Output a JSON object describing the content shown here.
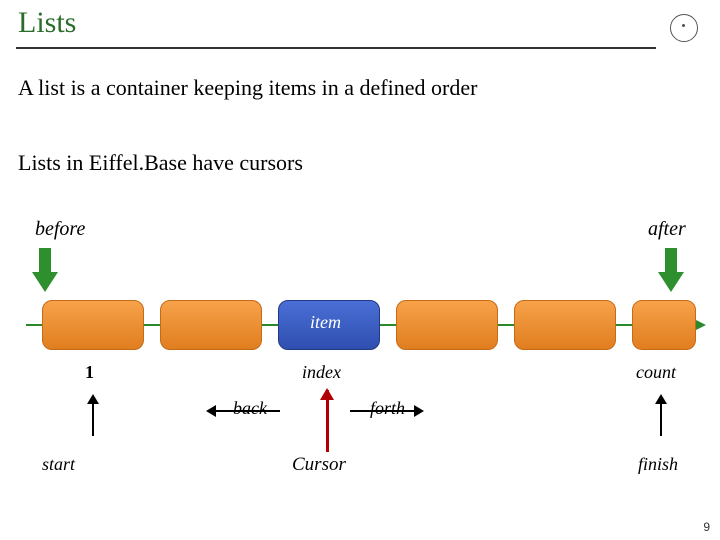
{
  "title": "Lists",
  "body_line1": "A list is a container keeping items in a defined order",
  "body_line2": "Lists in Eiffel.Base have cursors",
  "labels": {
    "before": "before",
    "after": "after",
    "item": "item",
    "index": "index",
    "one": "1",
    "count": "count",
    "back": "back",
    "forth": "forth",
    "start": "start",
    "finish": "finish",
    "cursor": "Cursor"
  },
  "page_number": "9"
}
